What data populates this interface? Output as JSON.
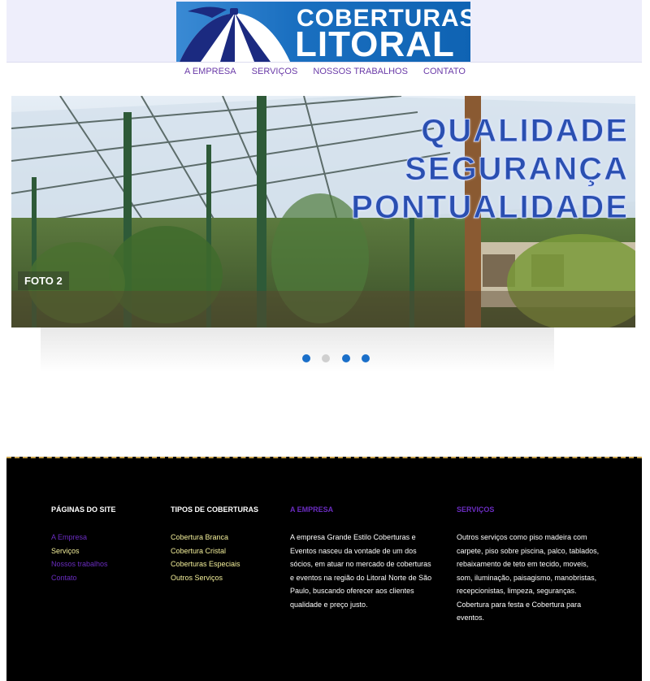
{
  "brand": {
    "line1": "COBERTURAS",
    "line2": "LITORAL"
  },
  "nav": {
    "items": [
      "A EMPRESA",
      "SERVIÇOS",
      "NOSSOS TRABALHOS",
      "CONTATO"
    ]
  },
  "slider": {
    "caption": "FOTO 2",
    "headline": [
      "QUALIDADE",
      "SEGURANÇA",
      "PONTUALIDADE"
    ],
    "active_slide": 1,
    "total_slides": 4
  },
  "footer": {
    "pages": {
      "title": "PÁGINAS DO SITE",
      "links": [
        "A Empresa",
        "Serviços",
        "Nossos trabalhos",
        "Contato"
      ]
    },
    "coverings": {
      "title": "TIPOS DE COBERTURAS",
      "links": [
        "Cobertura Branca",
        "Cobertura Cristal",
        "Coberturas Especiais",
        "Outros Serviços"
      ]
    },
    "company": {
      "title": "A EMPRESA",
      "text": "A empresa Grande Estilo Coberturas e Eventos nasceu da vontade de um dos sócios, em atuar no mercado de coberturas e eventos na região do Litoral Norte de São Paulo, buscando oferecer aos clientes qualidade e preço justo."
    },
    "services": {
      "title": "SERVIÇOS",
      "text": "Outros serviços como piso madeira com carpete, piso sobre piscina, palco, tablados, rebaixamento de teto em tecido, moveis, som, iluminação, paisagismo, manobristas, recepcionistas, limpeza, seguranças. Cobertura para festa e Cobertura para eventos."
    }
  },
  "colors": {
    "brand_blue": "#1a6fc0",
    "nav_purple": "#6a3aa8",
    "link_yellow": "#f3ef9a",
    "heading_purple": "#6a2cc0",
    "footer_bg": "#000000",
    "dot_active": "#1a6fc9"
  }
}
